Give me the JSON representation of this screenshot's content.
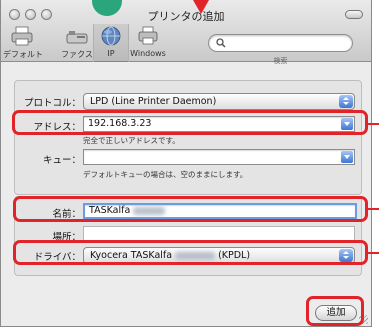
{
  "window": {
    "title": "プリンタの追加"
  },
  "toolbar": {
    "items": [
      {
        "label": "デフォルト",
        "icon": "printer-icon"
      },
      {
        "label": "ファクス",
        "icon": "fax-icon"
      },
      {
        "label": "IP",
        "icon": "globe-icon",
        "selected": true
      },
      {
        "label": "Windows",
        "icon": "windows-printer-icon"
      }
    ],
    "search_label": "検索"
  },
  "form": {
    "protocol_label": "プロトコル：",
    "protocol_value": "LPD (Line Printer Daemon)",
    "address_label": "アドレス：",
    "address_value": "192.168.3.23",
    "address_hint": "完全で正しいアドレスです。",
    "queue_label": "キュー：",
    "queue_value": "",
    "queue_hint": "デフォルトキューの場合は、空のままにします。",
    "name_label": "名前：",
    "name_value": "TASKalfa",
    "location_label": "場所：",
    "location_value": "",
    "driver_label": "ドライバ：",
    "driver_value_prefix": "Kyocera TASKalfa",
    "driver_value_suffix": "(KPDL)"
  },
  "buttons": {
    "add_label": "追加"
  },
  "colors": {
    "highlight": "#e0242a",
    "badge": "#2aa57c",
    "accent": "#3d76d4"
  }
}
